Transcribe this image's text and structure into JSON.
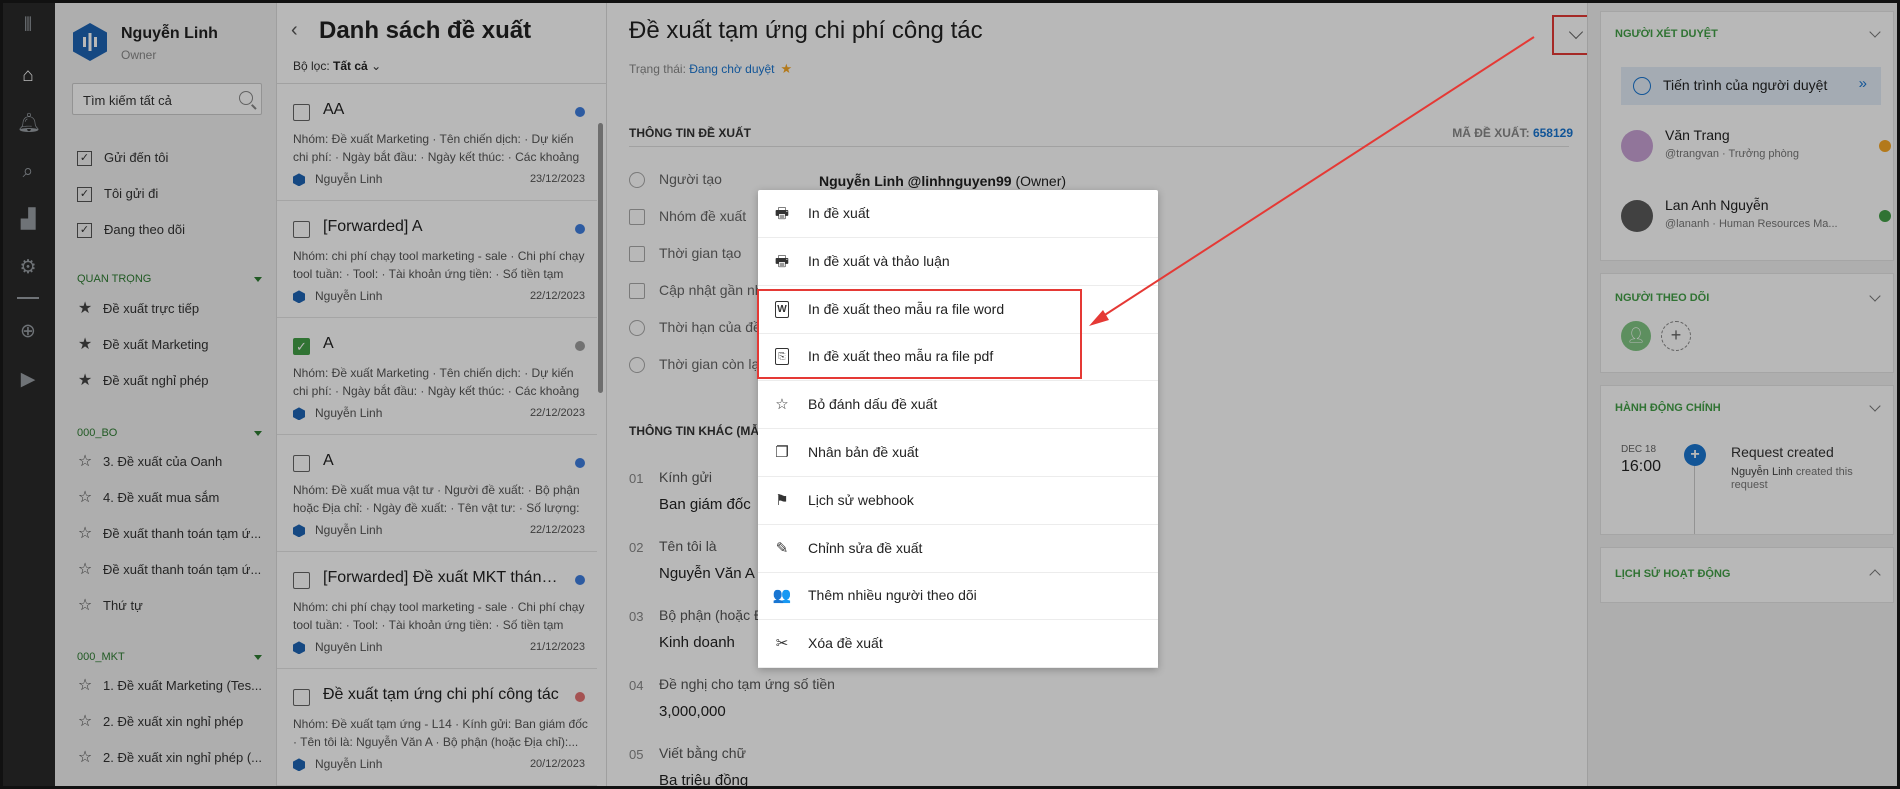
{
  "left": {
    "user_name": "Nguyễn Linh",
    "user_role": "Owner",
    "search_placeholder": "Tìm kiếm tất cả",
    "quick": [
      "Gửi đến tôi",
      "Tôi gửi đi",
      "Đang theo dõi"
    ],
    "section_important": "QUAN TRỌNG",
    "important": [
      "Đề xuất trực tiếp",
      "Đề xuất Marketing",
      "Đề xuất nghỉ phép"
    ],
    "section_bo": "000_BO",
    "bo": [
      "3. Đề xuất của Oanh",
      "4. Đề xuất mua sắm",
      "Đề xuất thanh toán tạm ứ...",
      "Đề xuất thanh toán tạm ứ...",
      "Thứ tự"
    ],
    "section_mkt": "000_MKT",
    "mkt": [
      "1. Đề xuất Marketing (Tes...",
      "2. Đề xuất xin nghỉ phép",
      "2. Đề xuất xin nghỉ phép (..."
    ]
  },
  "list": {
    "title": "Danh sách đề xuất",
    "filter_label": "Bộ lọc:",
    "filter_value": "Tất cả",
    "items": [
      {
        "title": "AA",
        "desc": "Nhóm: Đề xuất Marketing · Tên chiến dịch: · Dự kiến chi phí: · Ngày bắt đầu: · Ngày kết thúc: · Các khoảng chi...",
        "author": "Nguyễn Linh",
        "date": "23/12/2023",
        "dot": "#3f7fe0",
        "checked": false
      },
      {
        "title": "[Forwarded] A",
        "desc": "Nhóm: chi phí chạy tool marketing - sale · Chi phí chạy tool tuần: · Tool: · Tài khoản ứng tiền: · Số tiền tạm ứn...",
        "author": "Nguyễn Linh",
        "date": "22/12/2023",
        "dot": "#3f7fe0",
        "checked": false
      },
      {
        "title": "A",
        "desc": "Nhóm: Đề xuất Marketing · Tên chiến dịch: · Dự kiến chi phí: · Ngày bắt đầu: · Ngày kết thúc: · Các khoảng chi...",
        "author": "Nguyễn Linh",
        "date": "22/12/2023",
        "dot": "#9e9e9e",
        "checked": true
      },
      {
        "title": "A",
        "desc": "Nhóm: Đề xuất mua vật tư · Người đề xuất: · Bộ phận hoặc Địa chỉ: · Ngày đề xuất: · Tên vật tư: · Số lượng: ...",
        "author": "Nguyễn Linh",
        "date": "22/12/2023",
        "dot": "#3f7fe0",
        "checked": false
      },
      {
        "title": "[Forwarded] Đề xuất MKT tháng...",
        "desc": "Nhóm: chi phí chạy tool marketing - sale · Chi phí chạy tool tuần: · Tool: · Tài khoản ứng tiền: · Số tiền tạm ứn...",
        "author": "Nguyên Linh",
        "date": "21/12/2023",
        "dot": "#3f7fe0",
        "checked": false
      },
      {
        "title": "Đề xuất tạm ứng chi phí công tác",
        "desc": "Nhóm: Đề xuất tạm ứng - L14 · Kính gửi: Ban giám đốc · Tên tôi là: Nguyễn Văn A · Bộ phận (hoặc Địa chỉ):...",
        "author": "Nguyễn Linh",
        "date": "20/12/2023",
        "dot": "#e57373",
        "checked": false
      }
    ]
  },
  "main": {
    "title": "Đề xuất tạm ứng chi phí công tác",
    "state_label": "Trạng thái:",
    "state_value": "Đang chờ duyệt",
    "section_info": "THÔNG TIN ĐỀ XUẤT",
    "code_label": "MÃ ĐỀ XUẤT:",
    "code_value": "658129",
    "info_rows": [
      "Người tạo",
      "Nhóm đề xuất",
      "Thời gian tạo",
      "Cập nhật gần nhất",
      "Thời hạn của đề",
      "Thời gian còn lại"
    ],
    "creator_name": "Nguyễn Linh @linhnguyen99",
    "creator_role": "(Owner)",
    "section_other": "THÔNG TIN KHÁC (MẪU",
    "fields": [
      {
        "num": "01",
        "label": "Kính gửi",
        "value": "Ban giám đốc"
      },
      {
        "num": "02",
        "label": "Tên tôi là",
        "value": "Nguyễn Văn A"
      },
      {
        "num": "03",
        "label": "Bộ phận (hoặc Đ",
        "value": "Kinh doanh"
      },
      {
        "num": "04",
        "label": "Đề nghị cho tạm ứng số tiền",
        "value": "3,000,000"
      },
      {
        "num": "05",
        "label": "Viết bằng chữ",
        "value": "Ba triệu đồng"
      }
    ]
  },
  "menu": {
    "items": [
      {
        "label": "In đề xuất",
        "icon": "printer-icon",
        "glyph": "🖶"
      },
      {
        "label": "In đề xuất và thảo luận",
        "icon": "printer-icon",
        "glyph": "🖶"
      },
      {
        "label": "In đề xuất theo mẫu ra file word",
        "icon": "word-file-icon",
        "glyph": "W"
      },
      {
        "label": "In đề xuất theo mẫu ra file pdf",
        "icon": "pdf-file-icon",
        "glyph": "⎘"
      },
      {
        "label": "Bỏ đánh dấu đề xuất",
        "icon": "star-outline-icon",
        "glyph": "☆"
      },
      {
        "label": "Nhân bản đề xuất",
        "icon": "copy-icon",
        "glyph": "❐"
      },
      {
        "label": "Lịch sử webhook",
        "icon": "flag-icon",
        "glyph": "⚑"
      },
      {
        "label": "Chỉnh sửa đề xuất",
        "icon": "edit-icon",
        "glyph": "✎"
      },
      {
        "label": "Thêm nhiều người theo dõi",
        "icon": "people-icon",
        "glyph": "👥"
      },
      {
        "label": "Xóa đề xuất",
        "icon": "scissors-icon",
        "glyph": "✂"
      }
    ]
  },
  "right": {
    "approvers_title": "NGƯỜI XÉT DUYỆT",
    "progress_label": "Tiến trình của người duyệt",
    "approvers": [
      {
        "name": "Văn Trang",
        "sub": "@trangvan · Trưởng phòng",
        "status_color": "#f9a825"
      },
      {
        "name": "Lan Anh Nguyễn",
        "sub": "@lananh · Human Resources Ma...",
        "status_color": "#43a047"
      }
    ],
    "followers_title": "NGƯỜI THEO DÕI",
    "actions_title": "HÀNH ĐỘNG CHÍNH",
    "action_month": "DEC 18",
    "action_time": "16:00",
    "action_title": "Request created",
    "action_actor": "Nguyễn Linh",
    "action_desc": "created this request",
    "history_title": "LỊCH SỬ HOẠT ĐỘNG"
  },
  "colors": {
    "accent": "#1976d2",
    "green": "#43a047",
    "annotation": "#e53935"
  }
}
